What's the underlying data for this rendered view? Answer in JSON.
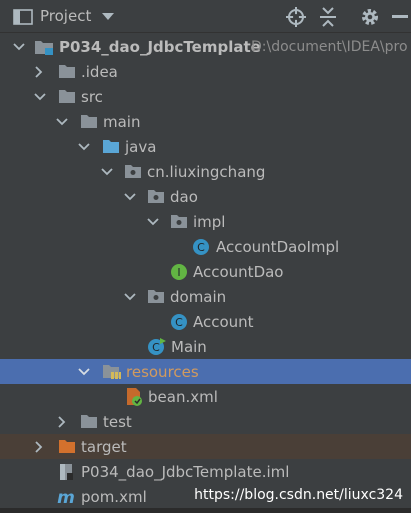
{
  "panel": {
    "title": "Project"
  },
  "tree": {
    "project_name": "P034_dao_JdbcTemplate",
    "project_path": "D:\\document\\IDEA\\pro",
    "nodes": {
      "idea": ".idea",
      "src": "src",
      "main": "main",
      "java": "java",
      "package": "cn.liuxingchang",
      "dao": "dao",
      "impl": "impl",
      "account_dao_impl": "AccountDaoImpl",
      "account_dao": "AccountDao",
      "domain": "domain",
      "account": "Account",
      "main_class": "Main",
      "resources": "resources",
      "bean_xml": "bean.xml",
      "test": "test",
      "target": "target",
      "iml": "P034_dao_JdbcTemplate.iml",
      "pom": "pom.xml"
    }
  },
  "watermark": "https://blog.csdn.net/liuxc324",
  "icons": {
    "panel": "project-panel-icon",
    "dropdown": "dropdown-icon",
    "locate": "locate-icon",
    "collapse": "collapse-all-icon",
    "settings": "gear-icon",
    "hide": "hide-icon"
  },
  "colors": {
    "background": "#3c3f41",
    "selection": "#4b6eaf",
    "excluded": "#4a3f37",
    "folder": "#8a9299",
    "source_folder": "#5aa6d6",
    "class": "#3592c4",
    "interface": "#62b543",
    "target_folder": "#d3712d"
  }
}
